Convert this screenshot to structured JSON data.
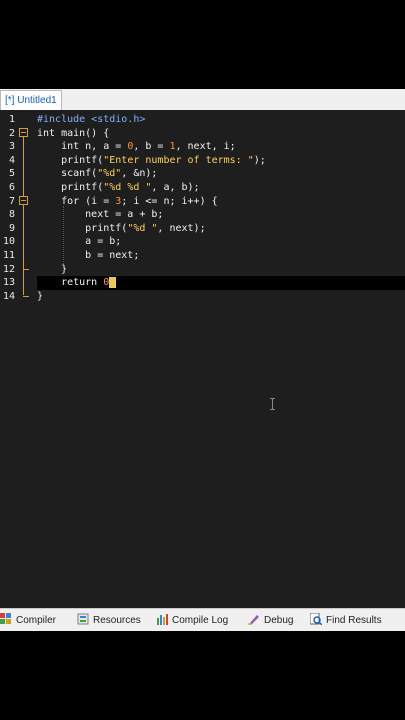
{
  "tab": {
    "label": "[*] Untitled1"
  },
  "editor": {
    "line_numbers": [
      "1",
      "2",
      "3",
      "4",
      "5",
      "6",
      "7",
      "8",
      "9",
      "10",
      "11",
      "12",
      "13",
      "14"
    ],
    "lines": [
      [
        {
          "t": "#include <stdio.h>",
          "c": "pp"
        }
      ],
      [
        {
          "t": "int main() {",
          "c": "kw"
        }
      ],
      [
        {
          "t": "    int n, a = ",
          "c": "kw"
        },
        {
          "t": "0",
          "c": "num"
        },
        {
          "t": ", b = ",
          "c": "kw"
        },
        {
          "t": "1",
          "c": "num"
        },
        {
          "t": ", next, i;",
          "c": "kw"
        }
      ],
      [
        {
          "t": "    printf(",
          "c": "kw"
        },
        {
          "t": "\"Enter number of terms: \"",
          "c": "str"
        },
        {
          "t": ");",
          "c": "kw"
        }
      ],
      [
        {
          "t": "    scanf(",
          "c": "kw"
        },
        {
          "t": "\"%d\"",
          "c": "str"
        },
        {
          "t": ", &n);",
          "c": "kw"
        }
      ],
      [
        {
          "t": "    printf(",
          "c": "kw"
        },
        {
          "t": "\"%d %d \"",
          "c": "str"
        },
        {
          "t": ", a, b);",
          "c": "kw"
        }
      ],
      [
        {
          "t": "    for (i = ",
          "c": "kw"
        },
        {
          "t": "3",
          "c": "num"
        },
        {
          "t": "; i <= n; i++) {",
          "c": "kw"
        }
      ],
      [
        {
          "t": "        next = a + b;",
          "c": "kw"
        }
      ],
      [
        {
          "t": "        printf(",
          "c": "kw"
        },
        {
          "t": "\"%d \"",
          "c": "str"
        },
        {
          "t": ", next);",
          "c": "kw"
        }
      ],
      [
        {
          "t": "        a = b;",
          "c": "kw"
        }
      ],
      [
        {
          "t": "        b = next;",
          "c": "kw"
        }
      ],
      [
        {
          "t": "    }",
          "c": "kw"
        }
      ],
      [
        {
          "t": "    return ",
          "c": "kw"
        },
        {
          "t": "0",
          "c": "num"
        }
      ],
      [
        {
          "t": "}",
          "c": "kw"
        }
      ]
    ]
  },
  "bottom_tabs": [
    {
      "label": "Compiler",
      "icon": "compiler-icon"
    },
    {
      "label": "Resources",
      "icon": "resources-icon"
    },
    {
      "label": "Compile Log",
      "icon": "compile-log-icon"
    },
    {
      "label": "Debug",
      "icon": "debug-icon"
    },
    {
      "label": "Find Results",
      "icon": "find-results-icon"
    }
  ]
}
